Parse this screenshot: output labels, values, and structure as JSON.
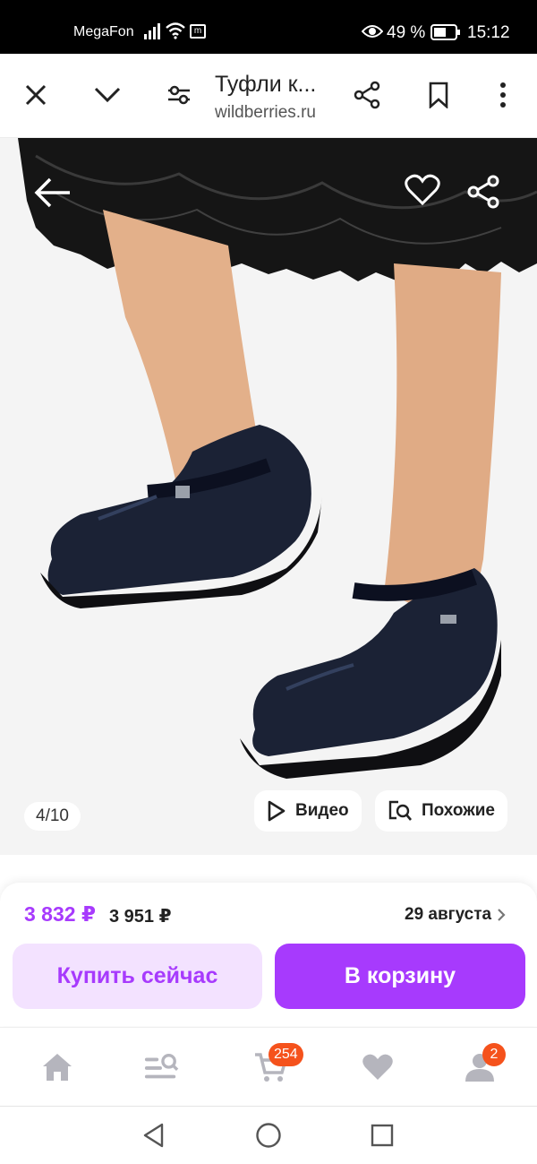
{
  "status_bar": {
    "carrier": "MegaFon",
    "battery_percent": "49 %",
    "time": "15:12",
    "m_icon_label": "m"
  },
  "browser_bar": {
    "title": "Туфли к...",
    "domain": "wildberries.ru"
  },
  "gallery": {
    "counter": "4/10",
    "video_label": "Видео",
    "similar_label": "Похожие"
  },
  "price": {
    "current": "3 832 ₽",
    "old": "3 951 ₽",
    "delivery": "29 августа"
  },
  "buttons": {
    "buy_now": "Купить сейчас",
    "add_to_cart": "В корзину"
  },
  "bottom_nav": {
    "cart_badge": "254",
    "profile_badge": "2"
  },
  "colors": {
    "accent": "#a73afd",
    "accent_light": "#f3e2ff",
    "badge": "#f5521c"
  }
}
